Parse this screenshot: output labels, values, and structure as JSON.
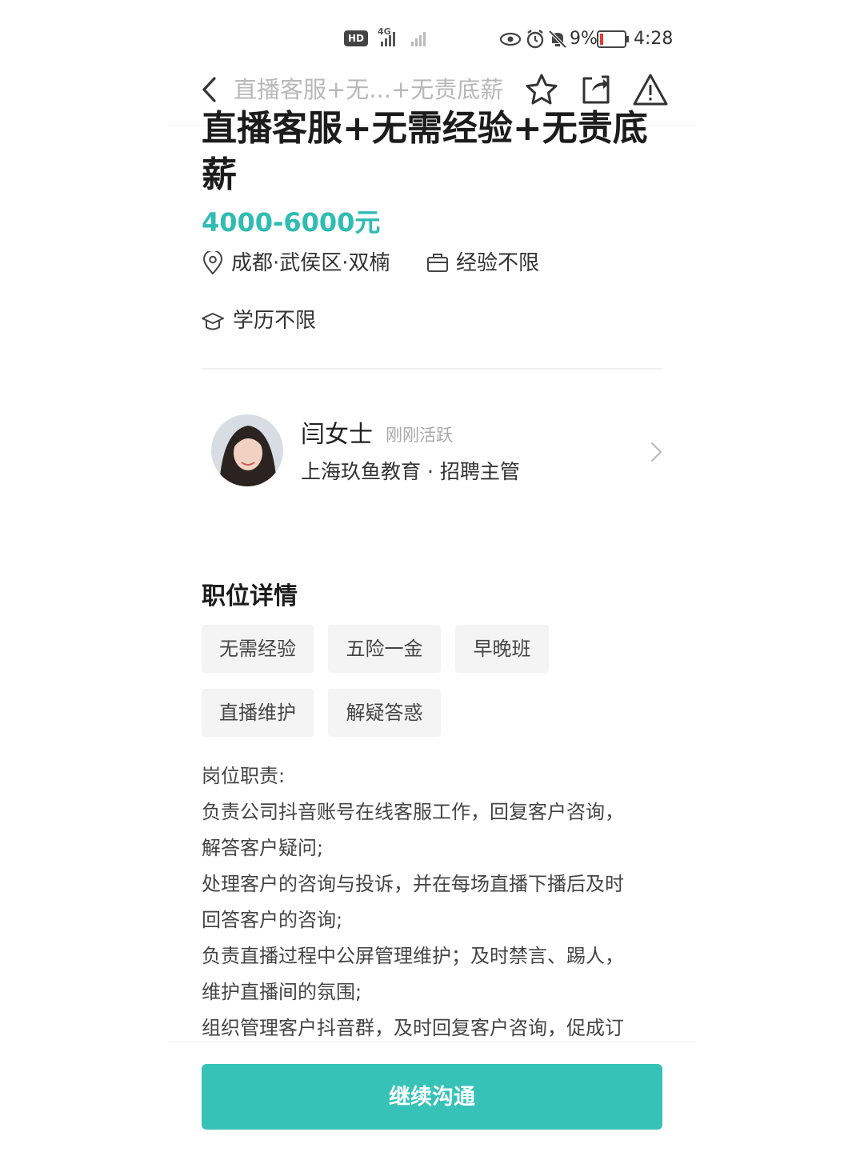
{
  "status_bar": {
    "network": "4G",
    "battery": "9%",
    "time": "4:28"
  },
  "nav": {
    "title": "直播客服+无...+无责底薪"
  },
  "job": {
    "title": "直播客服+无需经验+无责底薪",
    "salary": "4000-6000元",
    "location": "成都·武侯区·双楠",
    "experience": "经验不限",
    "education": "学历不限"
  },
  "recruiter": {
    "name": "闫女士",
    "status": "刚刚活跃",
    "company_role": "上海玖鱼教育 · 招聘主管"
  },
  "details": {
    "section_title": "职位详情",
    "tags": [
      "无需经验",
      "五险一金",
      "早晚班",
      "直播维护",
      "解疑答惑"
    ],
    "description": [
      "岗位职责:",
      "负责公司抖音账号在线客服工作，回复客户咨询，",
      "解答客户疑问;",
      "处理客户的咨询与投诉，并在每场直播下播后及时",
      "回答客户的咨询;",
      "负责直播过程中公屏管理维护；及时禁言、踢人，",
      "维护直播间的氛围;",
      "组织管理客户抖音群，及时回复客户咨询，促成订"
    ]
  },
  "cta": {
    "label": "继续沟通"
  },
  "colors": {
    "accent": "#2fbcb3",
    "button": "#37c2b8",
    "tag_bg": "#f4f4f4"
  },
  "icons": [
    "back-icon",
    "star-icon",
    "share-icon",
    "warning-icon",
    "location-pin-icon",
    "briefcase-icon",
    "graduation-cap-icon",
    "chevron-right-icon"
  ]
}
